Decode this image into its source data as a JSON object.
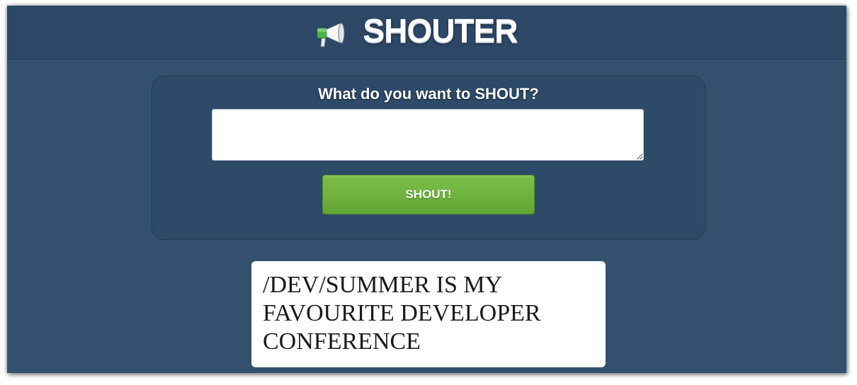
{
  "header": {
    "title": "SHOUTER",
    "logo_icon": "megaphone-icon",
    "background_color": "#2d4867"
  },
  "form": {
    "prompt_label": "What do you want to SHOUT?",
    "input_value": "",
    "input_placeholder": "",
    "button_label": "SHOUT!",
    "button_color": "#6db33f"
  },
  "shouts": [
    {
      "text": "/DEV/SUMMER IS MY FAVOURITE DEVELOPER CONFERENCE"
    }
  ],
  "colors": {
    "page_background": "#34506f",
    "panel_background": "#2e4a69",
    "card_background": "#ffffff"
  }
}
